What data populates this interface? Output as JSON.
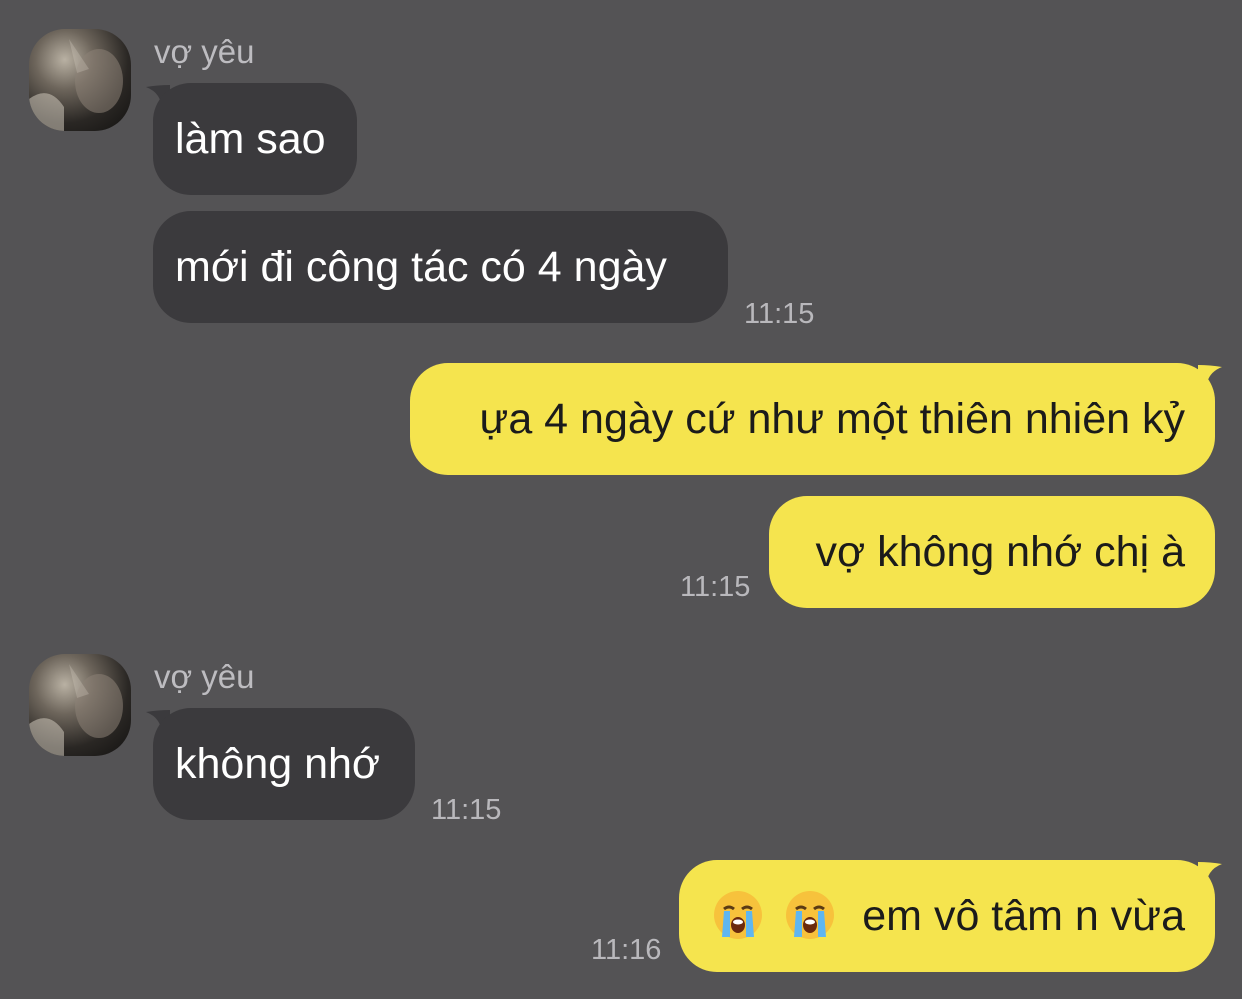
{
  "chat": {
    "contact_name": "vợ yêu",
    "colors": {
      "background": "#545355",
      "incoming": "#3b3a3d",
      "outgoing": "#f5e44e"
    },
    "groups": [
      {
        "sender": "vợ yêu",
        "avatar_icon": "avatar-photo-icon",
        "messages": [
          {
            "text": "làm sao"
          },
          {
            "text": "mới đi công tác có 4 ngày",
            "time": "11:15"
          }
        ]
      },
      {
        "sender": "me",
        "messages": [
          {
            "text": "ựa 4 ngày cứ như một thiên nhiên kỷ"
          },
          {
            "text": "vợ không nhớ chị à",
            "time": "11:15"
          }
        ]
      },
      {
        "sender": "vợ yêu",
        "avatar_icon": "avatar-photo-icon",
        "messages": [
          {
            "text": "không nhớ",
            "time": "11:15"
          }
        ]
      },
      {
        "sender": "me",
        "messages": [
          {
            "emojis": [
              "loudly-crying-face-icon",
              "loudly-crying-face-icon"
            ],
            "text": "em vô tâm n vừa",
            "time": "11:16"
          }
        ]
      }
    ]
  }
}
